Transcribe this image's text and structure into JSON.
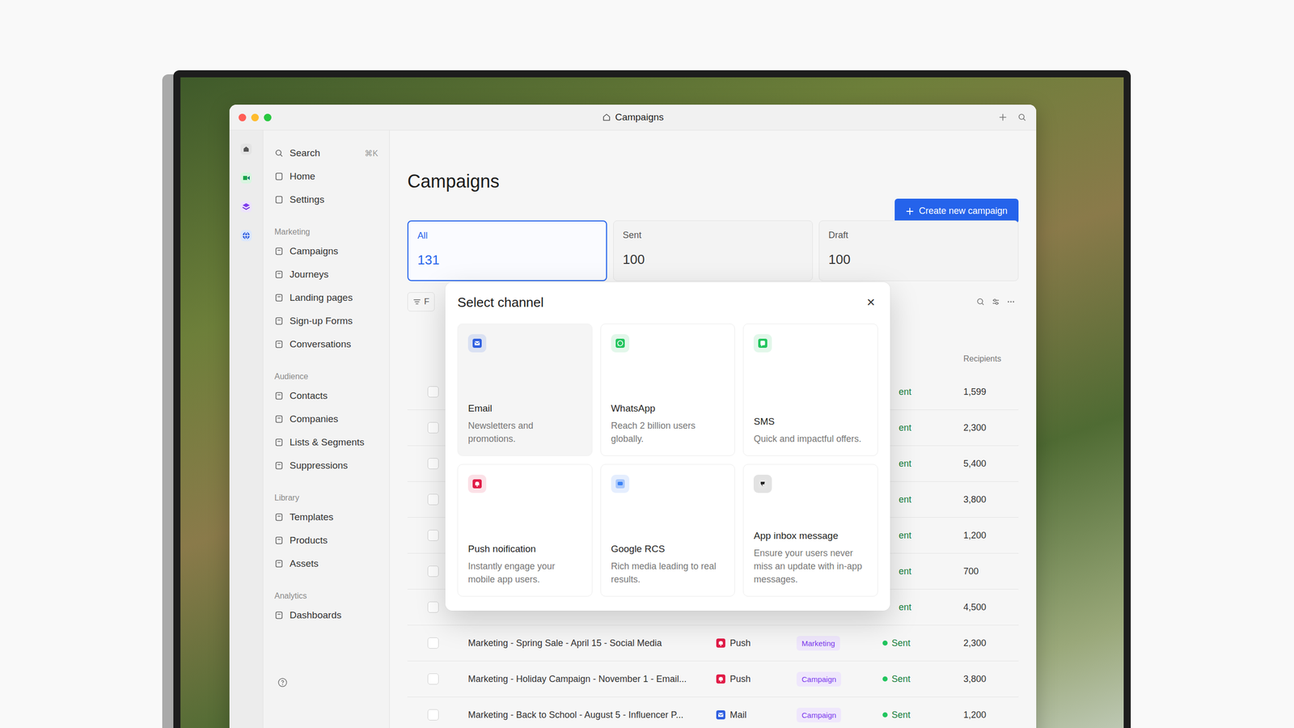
{
  "window": {
    "title": "Campaigns"
  },
  "sidebar": {
    "search": {
      "placeholder": "Search",
      "shortcut": "⌘K"
    },
    "top_items": [
      {
        "label": "Home",
        "selected": false
      },
      {
        "label": "Settings",
        "selected": false
      }
    ],
    "sections": [
      {
        "title": "Marketing",
        "items": [
          {
            "label": "Campaigns",
            "selected": false
          },
          {
            "label": "Journeys",
            "selected": false
          },
          {
            "label": "Landing pages",
            "selected": false
          },
          {
            "label": "Sign-up Forms",
            "selected": false
          },
          {
            "label": "Conversations",
            "selected": false
          }
        ]
      },
      {
        "title": "Audience",
        "items": [
          {
            "label": "Contacts",
            "selected": false
          },
          {
            "label": "Companies",
            "selected": false
          },
          {
            "label": "Lists & Segments",
            "selected": false
          },
          {
            "label": "Suppressions",
            "selected": false
          }
        ]
      },
      {
        "title": "Library",
        "items": [
          {
            "label": "Templates",
            "selected": false
          },
          {
            "label": "Products",
            "selected": false
          },
          {
            "label": "Assets",
            "selected": false
          }
        ]
      },
      {
        "title": "Analytics",
        "items": [
          {
            "label": "Dashboards",
            "selected": false
          }
        ]
      }
    ]
  },
  "page": {
    "title": "Campaigns",
    "create_button": "Create new campaign"
  },
  "stats": [
    {
      "label": "All",
      "value": "131",
      "selected": true
    },
    {
      "label": "Sent",
      "value": "100",
      "selected": false
    },
    {
      "label": "Draft",
      "value": "100",
      "selected": false
    }
  ],
  "filter": {
    "label": "F"
  },
  "table": {
    "recipients_header": "Recipients",
    "rows": [
      {
        "kind": "covered",
        "status": "ent",
        "recipients": "1,599"
      },
      {
        "kind": "covered",
        "status": "ent",
        "recipients": "2,300"
      },
      {
        "kind": "covered",
        "status": "ent",
        "recipients": "5,400"
      },
      {
        "kind": "covered",
        "status": "ent",
        "recipients": "3,800"
      },
      {
        "kind": "covered",
        "status": "ent",
        "recipients": "1,200"
      },
      {
        "kind": "covered",
        "status": "ent",
        "recipients": "700"
      },
      {
        "kind": "covered",
        "status": "ent",
        "recipients": "4,500"
      },
      {
        "kind": "full",
        "name": "Marketing - Spring Sale - April 15 - Social Media",
        "channel": "Push",
        "channel_kind": "push",
        "channel_color": "#e11d48",
        "tag": "Marketing",
        "status": "Sent",
        "recipients": "2,300"
      },
      {
        "kind": "full",
        "name": "Marketing - Holiday Campaign - November 1 - Email...",
        "channel": "Push",
        "channel_kind": "push",
        "channel_color": "#e11d48",
        "tag": "Campaign",
        "status": "Sent",
        "recipients": "3,800"
      },
      {
        "kind": "full",
        "name": "Marketing - Back to School - August 5 - Influencer P...",
        "channel": "Mail",
        "channel_kind": "mail",
        "channel_color": "#2f5fe0",
        "tag": "Campaign",
        "status": "Sent",
        "recipients": "1,200"
      }
    ]
  },
  "modal": {
    "title": "Select channel",
    "close": "×",
    "channels": [
      {
        "kind": "email",
        "label": "Email",
        "description": "Newsletters and promotions.",
        "color": "#2f5fe0",
        "hovered": true
      },
      {
        "kind": "whatsapp",
        "label": "WhatsApp",
        "description": "Reach 2 billion users globally.",
        "color": "#22c55e",
        "hovered": false
      },
      {
        "kind": "sms",
        "label": "SMS",
        "description": "Quick and impactful offers.",
        "color": "#22c55e",
        "hovered": false
      },
      {
        "kind": "push",
        "label": "Push noification",
        "description": "Instantly engage your mobile app users.",
        "color": "#e11d48",
        "hovered": false
      },
      {
        "kind": "rcs",
        "label": "Google RCS",
        "description": "Rich media leading to real results.",
        "color": "#3b82f6",
        "hovered": false
      },
      {
        "kind": "inbox",
        "label": "App inbox message",
        "description": "Ensure your users never miss an update with in-app messages.",
        "color": "#222222",
        "hovered": false
      }
    ]
  }
}
